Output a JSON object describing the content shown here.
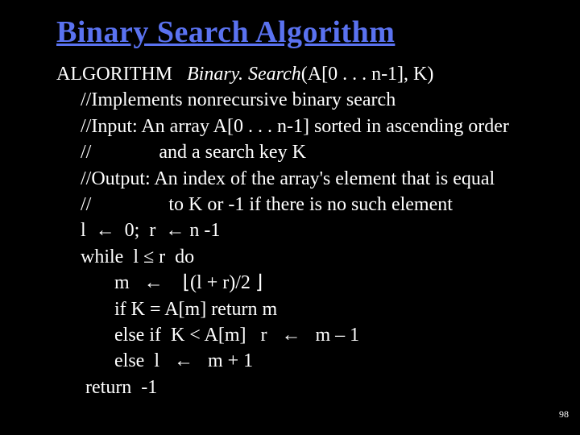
{
  "title": "Binary Search Algorithm",
  "algo_kw": "ALGORITHM",
  "algo_name": "Binary. Search",
  "algo_args": "(A[0 . . . n-1], K)",
  "lines": {
    "l1": "     //Implements nonrecursive binary search",
    "l2": "     //Input: An array A[0 . . . n-1] sorted in ascending order",
    "l3": "     //              and a search key K",
    "l4": "     //Output: An index of the array's element that is equal",
    "l5": "     //                to K or -1 if there is no such element",
    "l6": "     l  ←  0;  r  ← n -1",
    "l7": "     while  l ≤ r  do",
    "l8": "            m   ←    ⌊(l + r)/2 ⌋",
    "l9": "            if K = A[m] return m",
    "l10": "            else if  K < A[m]   r   ←   m – 1",
    "l11": "            else  l   ←   m + 1",
    "l12": "      return  -1"
  },
  "page_number": "98"
}
